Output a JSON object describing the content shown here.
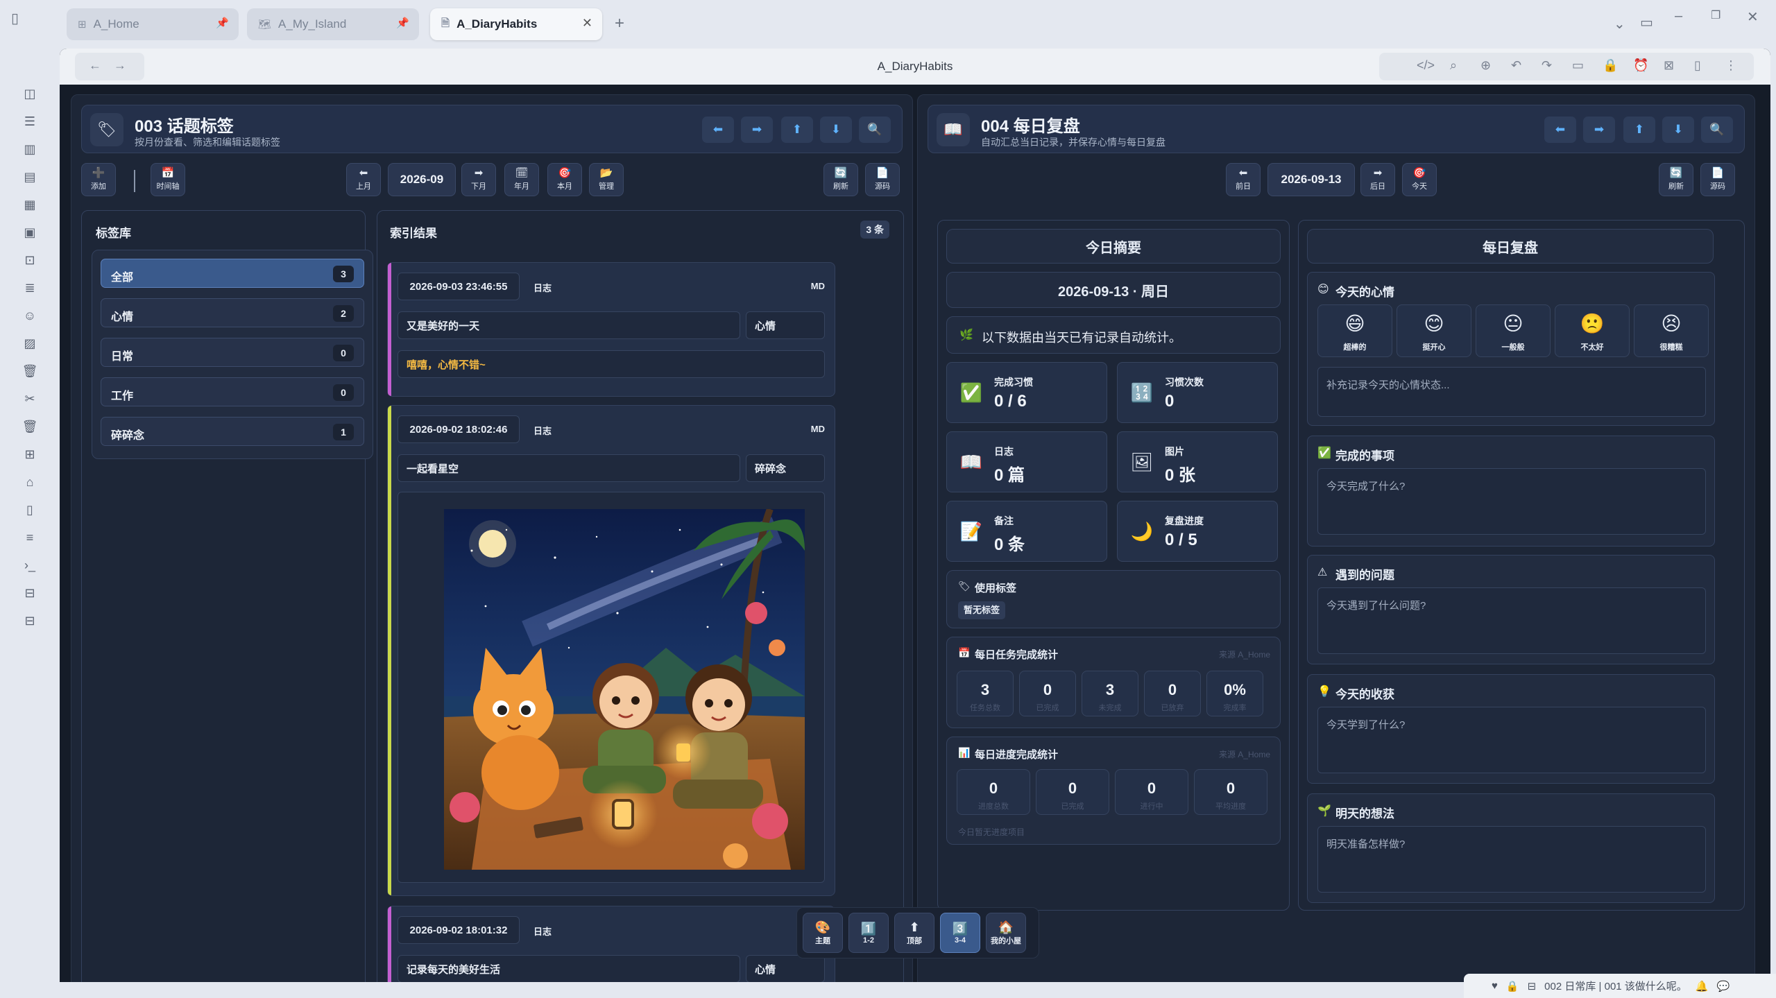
{
  "tabs": [
    {
      "label": "A_Home"
    },
    {
      "label": "A_My_Island"
    },
    {
      "label": "A_DiaryHabits"
    }
  ],
  "browser": {
    "title": "A_DiaryHabits"
  },
  "left_panel": {
    "title": "003 话题标签",
    "subtitle": "按月份查看、筛选和编辑话题标签",
    "toolbar": {
      "add": "添加",
      "timeline": "时间轴",
      "prev_month": "上月",
      "month": "2026-09",
      "next_month": "下月",
      "year_month": "年月",
      "this_month": "本月",
      "manage": "管理",
      "refresh": "刷新",
      "source": "源码"
    },
    "tag_library": {
      "title": "标签库",
      "items": [
        {
          "label": "全部",
          "count": "3"
        },
        {
          "label": "心情",
          "count": "2"
        },
        {
          "label": "日常",
          "count": "0"
        },
        {
          "label": "工作",
          "count": "0"
        },
        {
          "label": "碎碎念",
          "count": "1"
        }
      ]
    },
    "results": {
      "title": "索引结果",
      "count": "3 条",
      "entries": [
        {
          "time": "2026-09-03 23:46:55",
          "type": "日志",
          "format": "MD",
          "title": "又是美好的一天",
          "tag": "心情",
          "body": "嘻嘻，心情不错~",
          "color": "#c45fd1"
        },
        {
          "time": "2026-09-02 18:02:46",
          "type": "日志",
          "format": "MD",
          "title": "一起看星空",
          "tag": "碎碎念",
          "body": "",
          "color": "#c9d94a"
        },
        {
          "time": "2026-09-02 18:01:32",
          "type": "日志",
          "format": "",
          "title": "记录每天的美好生活",
          "tag": "心情",
          "body": "",
          "color": "#c45fd1"
        }
      ]
    }
  },
  "right_panel": {
    "title": "004 每日复盘",
    "subtitle": "自动汇总当日记录，并保存心情与每日复盘",
    "toolbar": {
      "prev_day": "前日",
      "date": "2026-09-13",
      "next_day": "后日",
      "today": "今天",
      "refresh": "刷新",
      "source": "源码"
    },
    "summary": {
      "title": "今日摘要",
      "date": "2026-09-13 · 周日",
      "note": "以下数据由当天已有记录自动统计。",
      "stats": [
        {
          "label": "完成习惯",
          "value": "0 / 6",
          "icon": "check-icon"
        },
        {
          "label": "习惯次数",
          "value": "0",
          "icon": "numbers-icon"
        },
        {
          "label": "日志",
          "value": "0 篇",
          "icon": "book-icon"
        },
        {
          "label": "图片",
          "value": "0 张",
          "icon": "picture-icon"
        },
        {
          "label": "备注",
          "value": "0 条",
          "icon": "memo-icon"
        },
        {
          "label": "复盘进度",
          "value": "0 / 5",
          "icon": "moon-icon"
        }
      ],
      "tags_used": {
        "title": "使用标签",
        "empty": "暂无标签"
      },
      "task_stats": {
        "title": "每日任务完成统计",
        "source": "来源 A_Home",
        "values": [
          "3",
          "0",
          "3",
          "0",
          "0%"
        ],
        "labels": [
          "任务总数",
          "已完成",
          "未完成",
          "已放弃",
          "完成率"
        ]
      },
      "progress_stats": {
        "title": "每日进度完成统计",
        "source": "来源 A_Home",
        "values": [
          "0",
          "0",
          "0",
          "0"
        ],
        "labels": [
          "进度总数",
          "已完成",
          "进行中",
          "平均进度"
        ],
        "footer": "今日暂无进度项目"
      }
    },
    "review": {
      "title": "每日复盘",
      "mood": {
        "title": "今天的心情",
        "options": [
          {
            "emoji": "😄",
            "label": "超棒的"
          },
          {
            "emoji": "😊",
            "label": "挺开心"
          },
          {
            "emoji": "😐",
            "label": "一般般"
          },
          {
            "emoji": "🙁",
            "label": "不太好"
          },
          {
            "emoji": "😣",
            "label": "很糟糕"
          }
        ],
        "placeholder": "补充记录今天的心情状态..."
      },
      "done": {
        "title": "完成的事项",
        "placeholder": "今天完成了什么?"
      },
      "problems": {
        "title": "遇到的问题",
        "placeholder": "今天遇到了什么问题?"
      },
      "gains": {
        "title": "今天的收获",
        "placeholder": "今天学到了什么?"
      },
      "tomorrow": {
        "title": "明天的想法",
        "placeholder": "明天准备怎样做?"
      }
    }
  },
  "floating_nav": [
    {
      "label": "主题",
      "icon": "palette-icon"
    },
    {
      "label": "1-2",
      "icon": "one-icon"
    },
    {
      "label": "顶部",
      "icon": "up-icon"
    },
    {
      "label": "3-4",
      "icon": "three-icon"
    },
    {
      "label": "我的小屋",
      "icon": "house-icon"
    }
  ],
  "statusbar": {
    "text": "002 日常库 | 001 该做什么呢。"
  }
}
